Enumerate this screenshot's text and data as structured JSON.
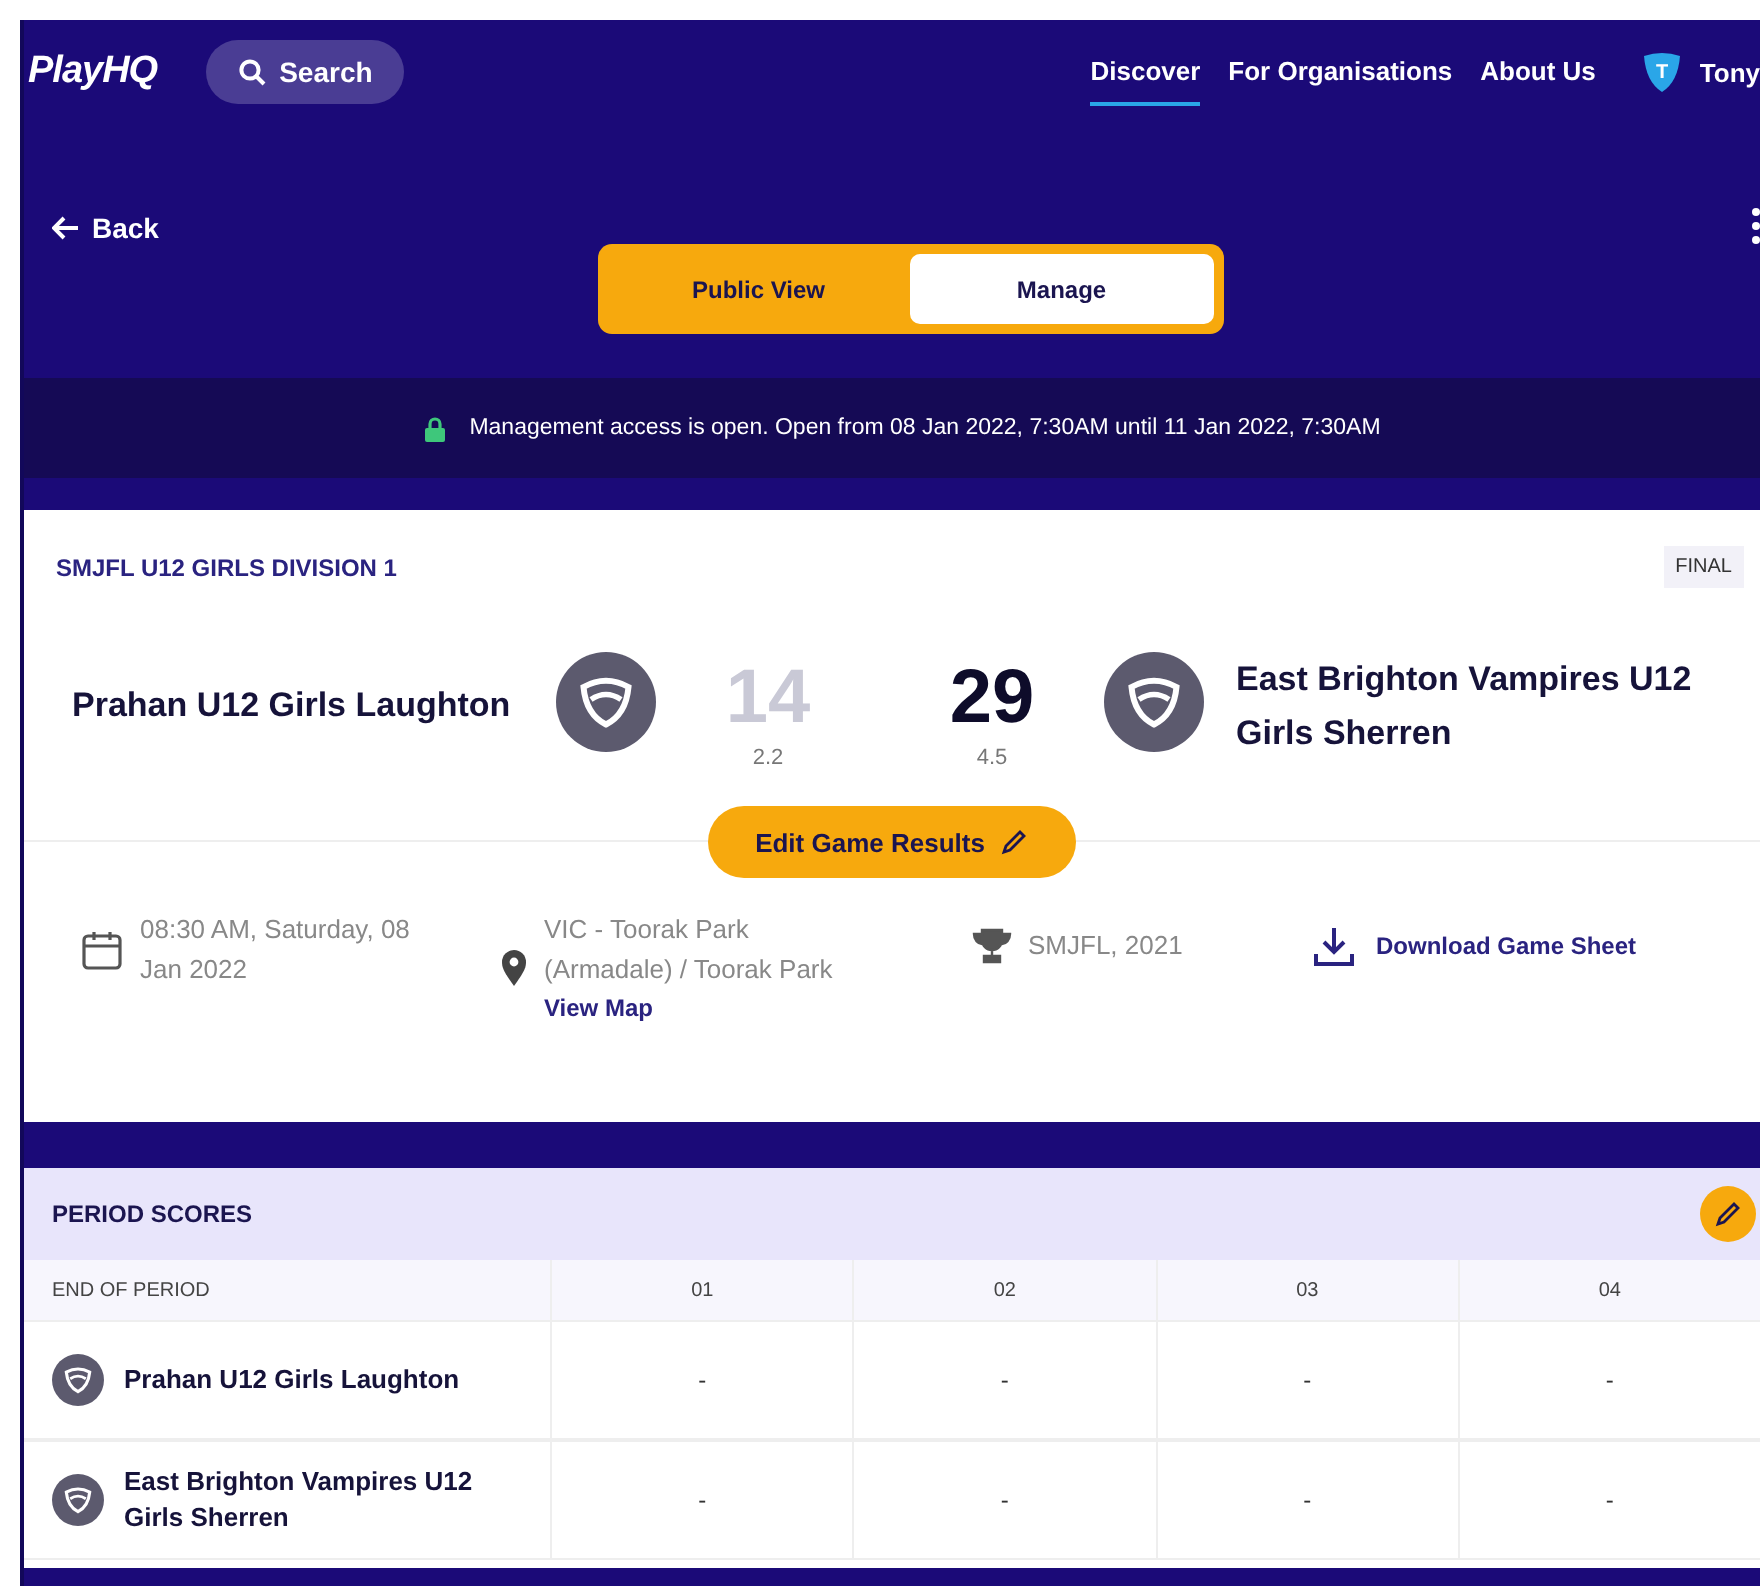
{
  "header": {
    "logo": "PlayHQ",
    "search": "Search",
    "nav": [
      {
        "label": "Discover",
        "selected": true
      },
      {
        "label": "For Organisations",
        "selected": false
      },
      {
        "label": "About Us",
        "selected": false
      }
    ],
    "user": {
      "initial": "T",
      "name": "Tony"
    }
  },
  "back": "Back",
  "view_toggle": [
    {
      "label": "Public View",
      "selected": false
    },
    {
      "label": "Manage",
      "selected": true
    }
  ],
  "banner": "Management access is open. Open from 08 Jan 2022, 7:30AM until 11 Jan 2022, 7:30AM",
  "match": {
    "competition": "SMJFL U12 GIRLS DIVISION 1",
    "status": "FINAL",
    "home": {
      "name": "Prahan U12 Girls Laughton",
      "score": "14",
      "breakdown": "2.2",
      "winner": false
    },
    "away": {
      "name": "East Brighton Vampires U12 Girls Sherren",
      "score": "29",
      "breakdown": "4.5",
      "winner": true
    },
    "edit_button": "Edit Game Results",
    "date": "08:30 AM, Saturday, 08 Jan 2022",
    "venue": "VIC - Toorak Park (Armadale) / Toorak Park",
    "map_link": "View Map",
    "season": "SMJFL, 2021",
    "download": "Download Game Sheet"
  },
  "period_scores": {
    "title": "PERIOD SCORES",
    "columns": [
      "END OF PERIOD",
      "01",
      "02",
      "03",
      "04"
    ],
    "rows": [
      {
        "cells": [
          "Prahan U12 Girls Laughton",
          "-",
          "-",
          "-",
          "-"
        ]
      },
      {
        "cells": [
          "East Brighton Vampires U12 Girls Sherren",
          "-",
          "-",
          "-",
          "-"
        ]
      }
    ]
  }
}
